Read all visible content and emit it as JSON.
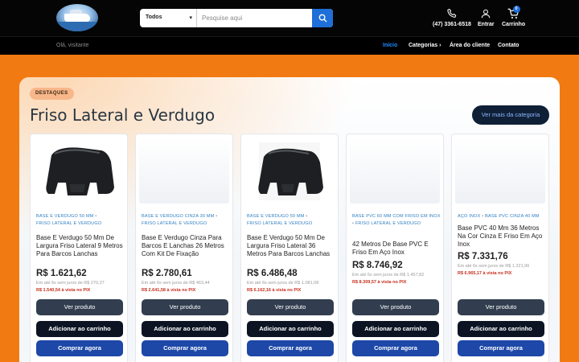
{
  "header": {
    "search": {
      "category_selected": "Todos",
      "placeholder": "Pesquise aqui"
    },
    "phone": "(47) 3361-6518",
    "login_label": "Entrar",
    "cart_label": "Carrinho",
    "cart_count": "0"
  },
  "nav": {
    "greeting": "Olá, visitante",
    "items": [
      "Início",
      "Categorias ›",
      "Área do cliente",
      "Contato"
    ]
  },
  "section": {
    "badge": "DESTAQUES",
    "title": "Friso Lateral e Verdugo",
    "more_label": "Ver mais da categoria"
  },
  "products": [
    {
      "cat1": "BASE E VERDUGO 50 MM",
      "cat2": "FRISO LATERAL E VERDUGO",
      "name": "Base E Verdugo 50 Mm De Largura Friso Lateral 9 Metros Para Barcos Lanchas",
      "price": "R$ 1.621,62",
      "installments": "Em até 6x sem juros de R$ 270,27",
      "pix": "R$ 1.540,54 à vista no PIX",
      "view_label": "Ver produto",
      "add_label": "Adicionar ao carrinho",
      "buy_label": "Comprar agora"
    },
    {
      "cat1": "BASE E VERDUGO CINZA 30 MM",
      "cat2": "FRISO LATERAL E VERDUGO",
      "name": "Base E Verdugo Cinza Para Barcos E Lanchas 26 Metros Com Kit De Fixação",
      "price": "R$ 2.780,61",
      "installments": "Em até 6x sem juros de R$ 463,44",
      "pix": "R$ 2.641,58 à vista no PIX",
      "view_label": "Ver produto",
      "add_label": "Adicionar ao carrinho",
      "buy_label": "Comprar agora"
    },
    {
      "cat1": "BASE E VERDUGO 50 MM",
      "cat2": "FRISO LATERAL E VERDUGO",
      "name": "Base E Verdugo 50 Mm De Largura Friso Lateral 36 Metros Para Barcos Lanchas",
      "price": "R$ 6.486,48",
      "installments": "Em até 6x sem juros de R$ 1.081,08",
      "pix": "R$ 6.162,16 à vista no PIX",
      "view_label": "Ver produto",
      "add_label": "Adicionar ao carrinho",
      "buy_label": "Comprar agora"
    },
    {
      "cat1": "BASE PVC 60 MM COM FRISO EM INOX",
      "cat2": "FRISO LATERAL E VERDUGO",
      "name": "42 Metros De Base PVC E Friso Em Aço Inox",
      "price": "R$ 8.746,92",
      "installments": "Em até 6x sem juros de R$ 1.457,82",
      "pix": "R$ 8.309,57 à vista no PIX",
      "view_label": "Ver produto",
      "add_label": "Adicionar ao carrinho",
      "buy_label": "Comprar agora"
    },
    {
      "cat1": "AÇO INOX",
      "cat2": "BASE PVC CINZA 40 MM",
      "name": "Base PVC 40 Mm 36 Metros Na Cor Cinza E Friso Em Aço Inox",
      "price": "R$ 7.331,76",
      "installments": "Em até 6x sem juros de R$ 1.221,96",
      "pix": "R$ 6.965,17 à vista no PIX",
      "view_label": "Ver produto",
      "add_label": "Adicionar ao carrinho",
      "buy_label": "Comprar agora"
    }
  ],
  "colors": {
    "page_bg": "#f27a12",
    "header_bg": "#050505",
    "accent_blue": "#1e6fd8",
    "pix_red": "#c7301e",
    "buy_button": "#1d48a8"
  }
}
